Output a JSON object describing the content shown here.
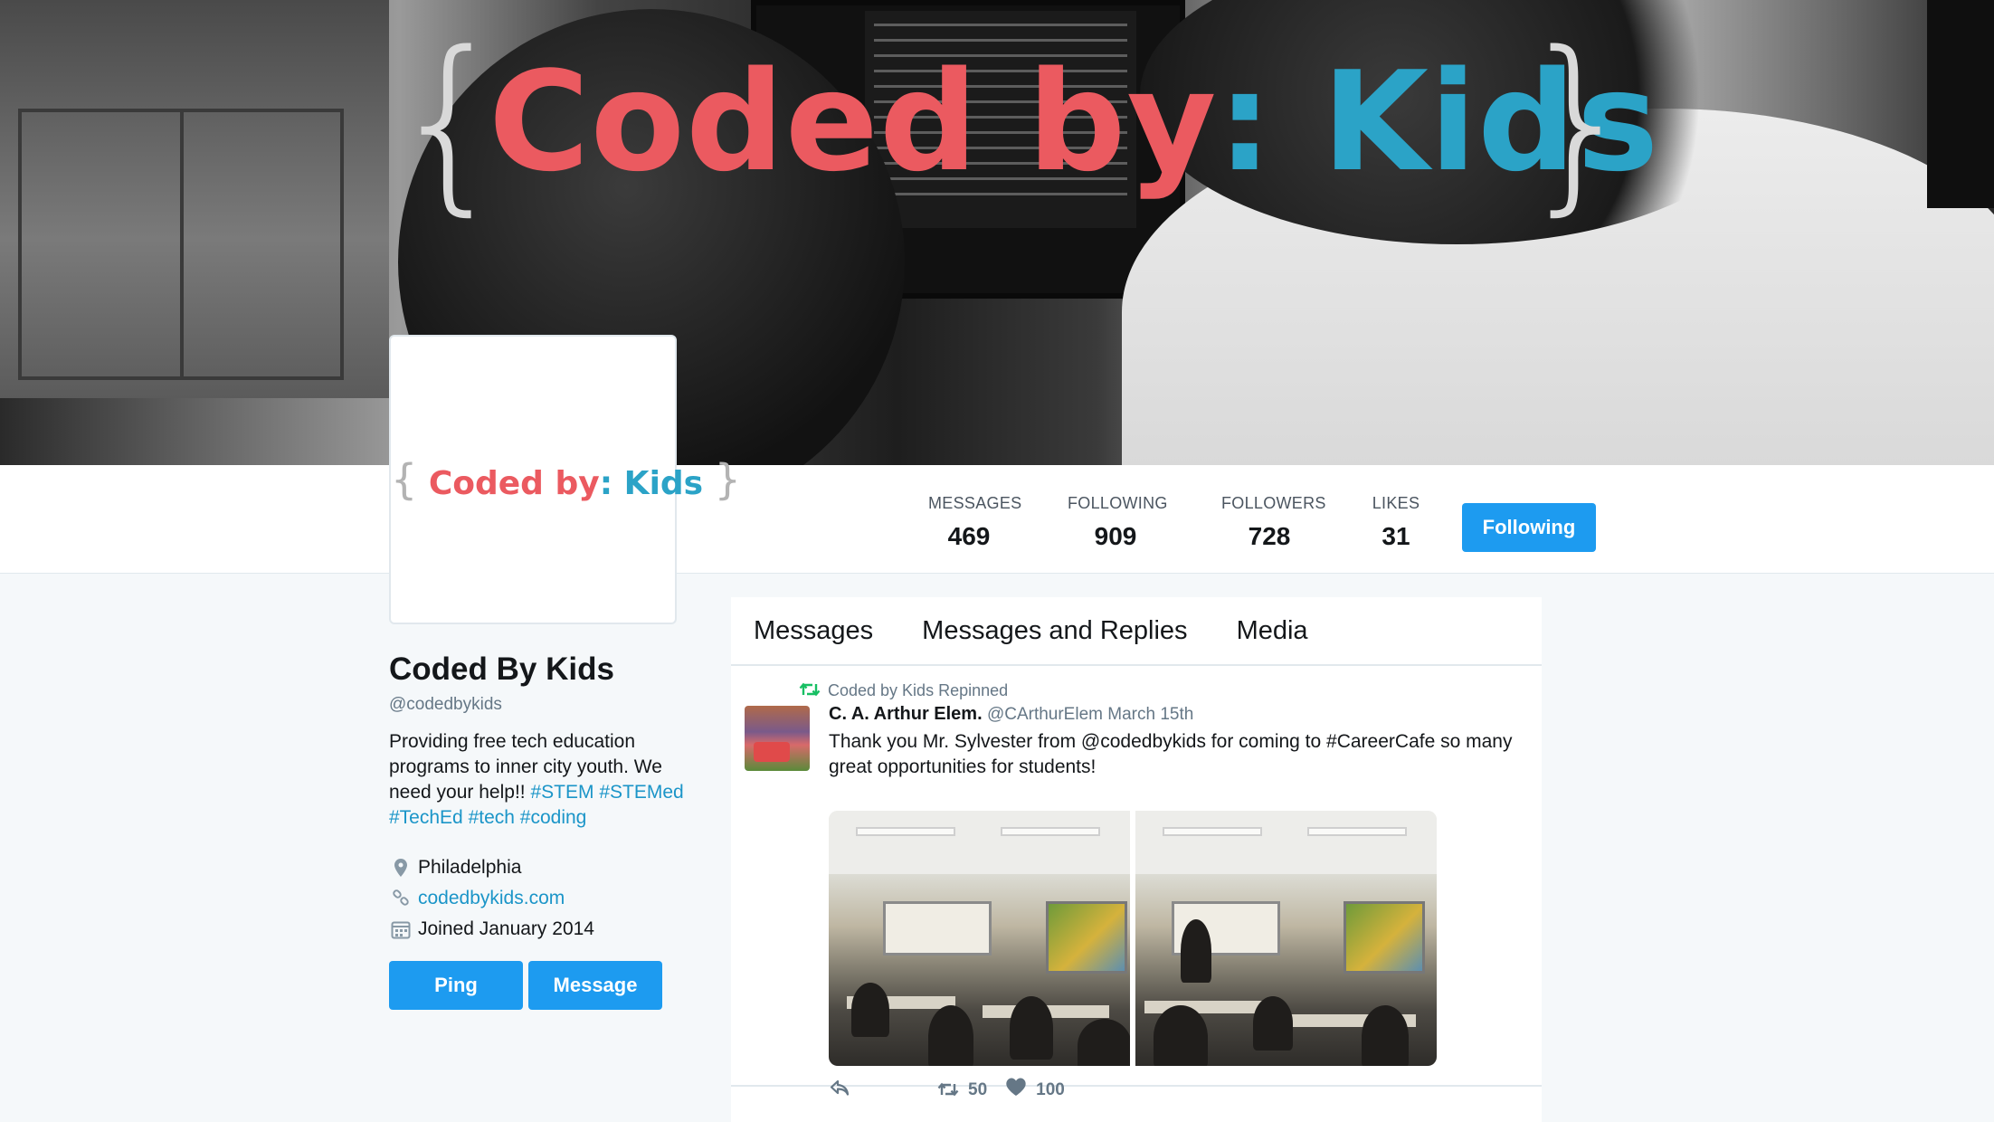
{
  "banner": {
    "brace_left": "{",
    "brace_right": "}",
    "title_part1": "Coded by",
    "title_colon": ":",
    "title_part2": "Kids",
    "colors": {
      "red": "#eb5a60",
      "teal": "#2ba3c7"
    }
  },
  "avatar": {
    "brace_left": "{",
    "brace_right": "}",
    "part1": "Coded by",
    "colon": ":",
    "part2": "Kids"
  },
  "stats": [
    {
      "label": "Messages",
      "value": "469"
    },
    {
      "label": "Following",
      "value": "909"
    },
    {
      "label": "Followers",
      "value": "728"
    },
    {
      "label": "Likes",
      "value": "31"
    }
  ],
  "following_button": "Following",
  "profile": {
    "name": "Coded By Kids",
    "handle": "@codedbykids",
    "bio_text": "Providing free tech education programs to inner city youth. We need your help!!",
    "bio_tags": [
      "#STEM",
      "#STEMed",
      "#TechEd",
      "#tech",
      "#coding"
    ],
    "location": "Philadelphia",
    "location_icon": "location-pin-icon",
    "website": "codedbykids.com",
    "website_icon": "link-icon",
    "joined": "Joined January 2014",
    "joined_icon": "calendar-icon",
    "ping_button": "Ping",
    "message_button": "Message"
  },
  "tabs": [
    "Messages",
    "Messages and Replies",
    "Media"
  ],
  "tweet": {
    "repin_text": "Coded by Kids Repinned",
    "repin_icon": "repin-icon",
    "author": "C. A. Arthur Elem.",
    "handle": "@CArthurElem",
    "date": "March 15th",
    "text": "Thank you Mr. Sylvester from @codedbykids for coming to #CareerCafe so many great opportunities for students!",
    "reply_icon": "reply-icon",
    "repin_count": "50",
    "repin_action_icon": "repin-icon",
    "like_count": "100",
    "like_icon": "heart-icon"
  },
  "accent_color": "#1d9bf0"
}
